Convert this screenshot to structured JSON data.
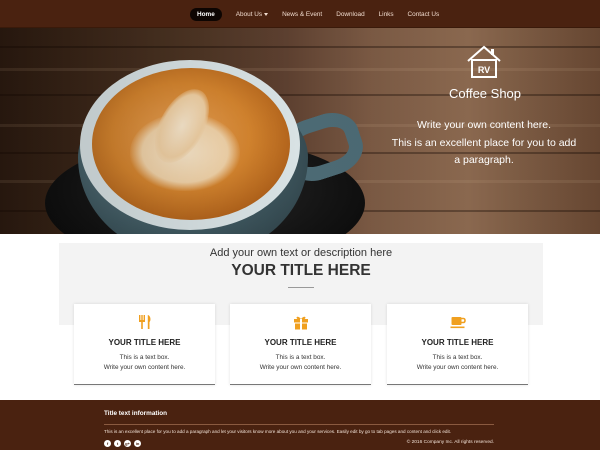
{
  "nav": {
    "items": [
      {
        "label": "Home",
        "active": true
      },
      {
        "label": "About Us",
        "dropdown": true
      },
      {
        "label": "News & Event"
      },
      {
        "label": "Download"
      },
      {
        "label": "Links"
      },
      {
        "label": "Contact Us"
      }
    ]
  },
  "hero": {
    "logo_text": "RV",
    "brand": "Coffee Shop",
    "line1": "Write your own content here.",
    "line2": "This is an excellent place for you to add",
    "line3": "a paragraph."
  },
  "main": {
    "subtitle": "Add your own text or description here",
    "title": "YOUR TITLE HERE",
    "cards": [
      {
        "icon": "cutlery-icon",
        "title": "YOUR TITLE HERE",
        "text1": "This is a text box.",
        "text2": "Write your own content here."
      },
      {
        "icon": "gift-icon",
        "title": "YOUR TITLE HERE",
        "text1": "This is a text box.",
        "text2": "Write your own content here."
      },
      {
        "icon": "coffee-cup-icon",
        "title": "YOUR TITLE HERE",
        "text1": "This is a text box.",
        "text2": "Write your own content here."
      }
    ]
  },
  "footer": {
    "title": "Title text information",
    "text": "This is an excellent place for you to add a paragraph and let your visitors know more about you and your services. Easily edit by go to tab pages and content and click edit.",
    "copyright": "© 2016 Company Inc. All rights reserved.",
    "social": [
      "f",
      "t",
      "g+",
      "in"
    ]
  },
  "colors": {
    "brand_brown": "#4a2210",
    "icon_orange": "#f0a020"
  }
}
